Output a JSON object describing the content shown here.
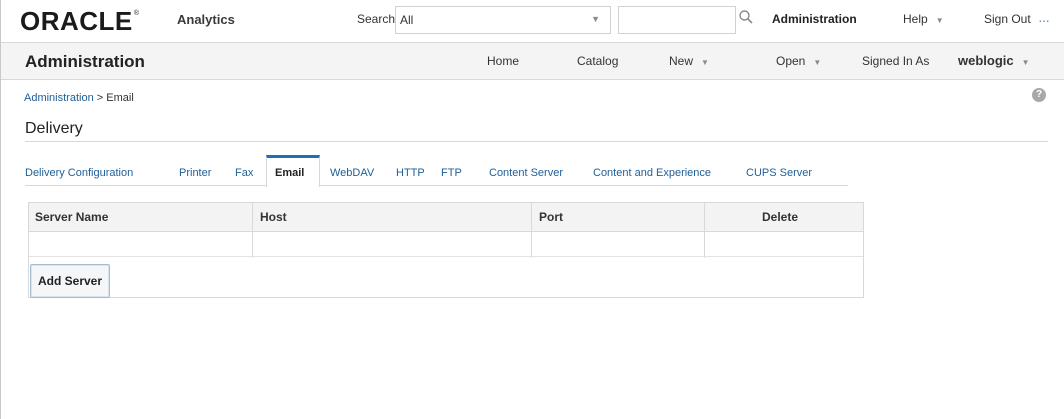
{
  "brand": {
    "logo_text": "ORACLE",
    "logo_mark": "®",
    "product": "Analytics"
  },
  "topbar": {
    "search_label": "Search",
    "search_scope": "All",
    "search_value": "",
    "administration": "Administration",
    "help": "Help",
    "sign_out": "Sign Out"
  },
  "subbar": {
    "title": "Administration",
    "home": "Home",
    "catalog": "Catalog",
    "new": "New",
    "open": "Open",
    "signed_in_as": "Signed In As",
    "user": "weblogic"
  },
  "breadcrumb": {
    "parent": "Administration",
    "separator": ">",
    "current": "Email"
  },
  "help_icon_glyph": "?",
  "section": {
    "title": "Delivery"
  },
  "tabs": [
    {
      "label": "Delivery Configuration"
    },
    {
      "label": "Printer"
    },
    {
      "label": "Fax"
    },
    {
      "label": "Email",
      "active": true
    },
    {
      "label": "WebDAV"
    },
    {
      "label": "HTTP"
    },
    {
      "label": "FTP"
    },
    {
      "label": "Content Server"
    },
    {
      "label": "Content and Experience"
    },
    {
      "label": "CUPS Server"
    }
  ],
  "table": {
    "columns": [
      "Server Name",
      "Host",
      "Port",
      "Delete"
    ],
    "rows": []
  },
  "add_server_label": "Add Server",
  "colors": {
    "accent": "#1f6fb8",
    "link": "#1f5e96",
    "header_bg": "#f4f4f4"
  }
}
